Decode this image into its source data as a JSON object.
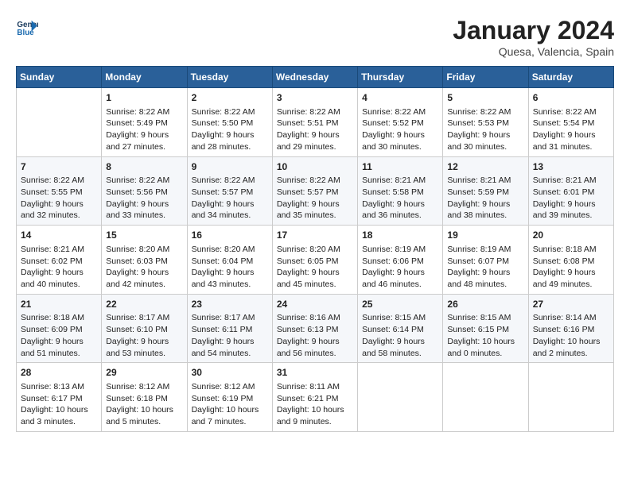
{
  "header": {
    "logo_line1": "General",
    "logo_line2": "Blue",
    "month_year": "January 2024",
    "location": "Quesa, Valencia, Spain"
  },
  "columns": [
    "Sunday",
    "Monday",
    "Tuesday",
    "Wednesday",
    "Thursday",
    "Friday",
    "Saturday"
  ],
  "weeks": [
    [
      {
        "day": "",
        "data": ""
      },
      {
        "day": "1",
        "data": "Sunrise: 8:22 AM\nSunset: 5:49 PM\nDaylight: 9 hours\nand 27 minutes."
      },
      {
        "day": "2",
        "data": "Sunrise: 8:22 AM\nSunset: 5:50 PM\nDaylight: 9 hours\nand 28 minutes."
      },
      {
        "day": "3",
        "data": "Sunrise: 8:22 AM\nSunset: 5:51 PM\nDaylight: 9 hours\nand 29 minutes."
      },
      {
        "day": "4",
        "data": "Sunrise: 8:22 AM\nSunset: 5:52 PM\nDaylight: 9 hours\nand 30 minutes."
      },
      {
        "day": "5",
        "data": "Sunrise: 8:22 AM\nSunset: 5:53 PM\nDaylight: 9 hours\nand 30 minutes."
      },
      {
        "day": "6",
        "data": "Sunrise: 8:22 AM\nSunset: 5:54 PM\nDaylight: 9 hours\nand 31 minutes."
      }
    ],
    [
      {
        "day": "7",
        "data": "Sunrise: 8:22 AM\nSunset: 5:55 PM\nDaylight: 9 hours\nand 32 minutes."
      },
      {
        "day": "8",
        "data": "Sunrise: 8:22 AM\nSunset: 5:56 PM\nDaylight: 9 hours\nand 33 minutes."
      },
      {
        "day": "9",
        "data": "Sunrise: 8:22 AM\nSunset: 5:57 PM\nDaylight: 9 hours\nand 34 minutes."
      },
      {
        "day": "10",
        "data": "Sunrise: 8:22 AM\nSunset: 5:57 PM\nDaylight: 9 hours\nand 35 minutes."
      },
      {
        "day": "11",
        "data": "Sunrise: 8:21 AM\nSunset: 5:58 PM\nDaylight: 9 hours\nand 36 minutes."
      },
      {
        "day": "12",
        "data": "Sunrise: 8:21 AM\nSunset: 5:59 PM\nDaylight: 9 hours\nand 38 minutes."
      },
      {
        "day": "13",
        "data": "Sunrise: 8:21 AM\nSunset: 6:01 PM\nDaylight: 9 hours\nand 39 minutes."
      }
    ],
    [
      {
        "day": "14",
        "data": "Sunrise: 8:21 AM\nSunset: 6:02 PM\nDaylight: 9 hours\nand 40 minutes."
      },
      {
        "day": "15",
        "data": "Sunrise: 8:20 AM\nSunset: 6:03 PM\nDaylight: 9 hours\nand 42 minutes."
      },
      {
        "day": "16",
        "data": "Sunrise: 8:20 AM\nSunset: 6:04 PM\nDaylight: 9 hours\nand 43 minutes."
      },
      {
        "day": "17",
        "data": "Sunrise: 8:20 AM\nSunset: 6:05 PM\nDaylight: 9 hours\nand 45 minutes."
      },
      {
        "day": "18",
        "data": "Sunrise: 8:19 AM\nSunset: 6:06 PM\nDaylight: 9 hours\nand 46 minutes."
      },
      {
        "day": "19",
        "data": "Sunrise: 8:19 AM\nSunset: 6:07 PM\nDaylight: 9 hours\nand 48 minutes."
      },
      {
        "day": "20",
        "data": "Sunrise: 8:18 AM\nSunset: 6:08 PM\nDaylight: 9 hours\nand 49 minutes."
      }
    ],
    [
      {
        "day": "21",
        "data": "Sunrise: 8:18 AM\nSunset: 6:09 PM\nDaylight: 9 hours\nand 51 minutes."
      },
      {
        "day": "22",
        "data": "Sunrise: 8:17 AM\nSunset: 6:10 PM\nDaylight: 9 hours\nand 53 minutes."
      },
      {
        "day": "23",
        "data": "Sunrise: 8:17 AM\nSunset: 6:11 PM\nDaylight: 9 hours\nand 54 minutes."
      },
      {
        "day": "24",
        "data": "Sunrise: 8:16 AM\nSunset: 6:13 PM\nDaylight: 9 hours\nand 56 minutes."
      },
      {
        "day": "25",
        "data": "Sunrise: 8:15 AM\nSunset: 6:14 PM\nDaylight: 9 hours\nand 58 minutes."
      },
      {
        "day": "26",
        "data": "Sunrise: 8:15 AM\nSunset: 6:15 PM\nDaylight: 10 hours\nand 0 minutes."
      },
      {
        "day": "27",
        "data": "Sunrise: 8:14 AM\nSunset: 6:16 PM\nDaylight: 10 hours\nand 2 minutes."
      }
    ],
    [
      {
        "day": "28",
        "data": "Sunrise: 8:13 AM\nSunset: 6:17 PM\nDaylight: 10 hours\nand 3 minutes."
      },
      {
        "day": "29",
        "data": "Sunrise: 8:12 AM\nSunset: 6:18 PM\nDaylight: 10 hours\nand 5 minutes."
      },
      {
        "day": "30",
        "data": "Sunrise: 8:12 AM\nSunset: 6:19 PM\nDaylight: 10 hours\nand 7 minutes."
      },
      {
        "day": "31",
        "data": "Sunrise: 8:11 AM\nSunset: 6:21 PM\nDaylight: 10 hours\nand 9 minutes."
      },
      {
        "day": "",
        "data": ""
      },
      {
        "day": "",
        "data": ""
      },
      {
        "day": "",
        "data": ""
      }
    ]
  ]
}
